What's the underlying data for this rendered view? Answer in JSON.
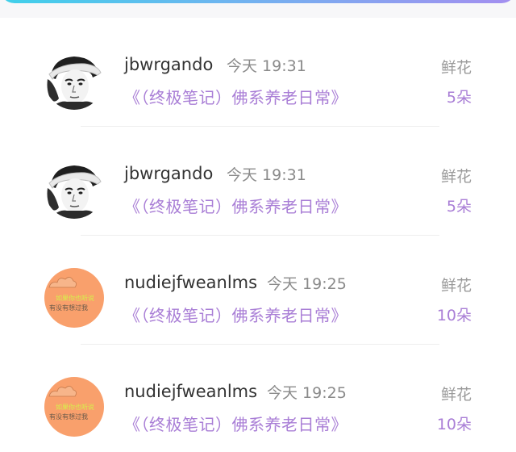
{
  "colors": {
    "accent_purple": "#a97ed6",
    "top_bar_gradient": [
      "#3fd0ea",
      "#6fb4f0",
      "#a48ef0"
    ],
    "orange_avatar": "#f9a06c"
  },
  "records": [
    {
      "username": "jbwrgando",
      "time": "今天 19:31",
      "book_title": "《（终极笔记）佛系养老日常》",
      "gift_type": "鲜花",
      "gift_count": "5朵",
      "avatar_icon": "portrait-photo-avatar"
    },
    {
      "username": "jbwrgando",
      "time": "今天 19:31",
      "book_title": "《（终极笔记）佛系养老日常》",
      "gift_type": "鲜花",
      "gift_count": "5朵",
      "avatar_icon": "portrait-photo-avatar"
    },
    {
      "username": "nudiejfweanlms",
      "time": "今天 19:25",
      "book_title": "《（终极笔记）佛系养老日常》",
      "gift_type": "鲜花",
      "gift_count": "10朵",
      "avatar_icon": "orange-text-avatar",
      "avatar_text": [
        "如果你也听说",
        "有没有想过我"
      ]
    },
    {
      "username": "nudiejfweanlms",
      "time": "今天 19:25",
      "book_title": "《（终极笔记）佛系养老日常》",
      "gift_type": "鲜花",
      "gift_count": "10朵",
      "avatar_icon": "orange-text-avatar",
      "avatar_text": [
        "如果你也听说",
        "有没有想过我"
      ]
    }
  ]
}
